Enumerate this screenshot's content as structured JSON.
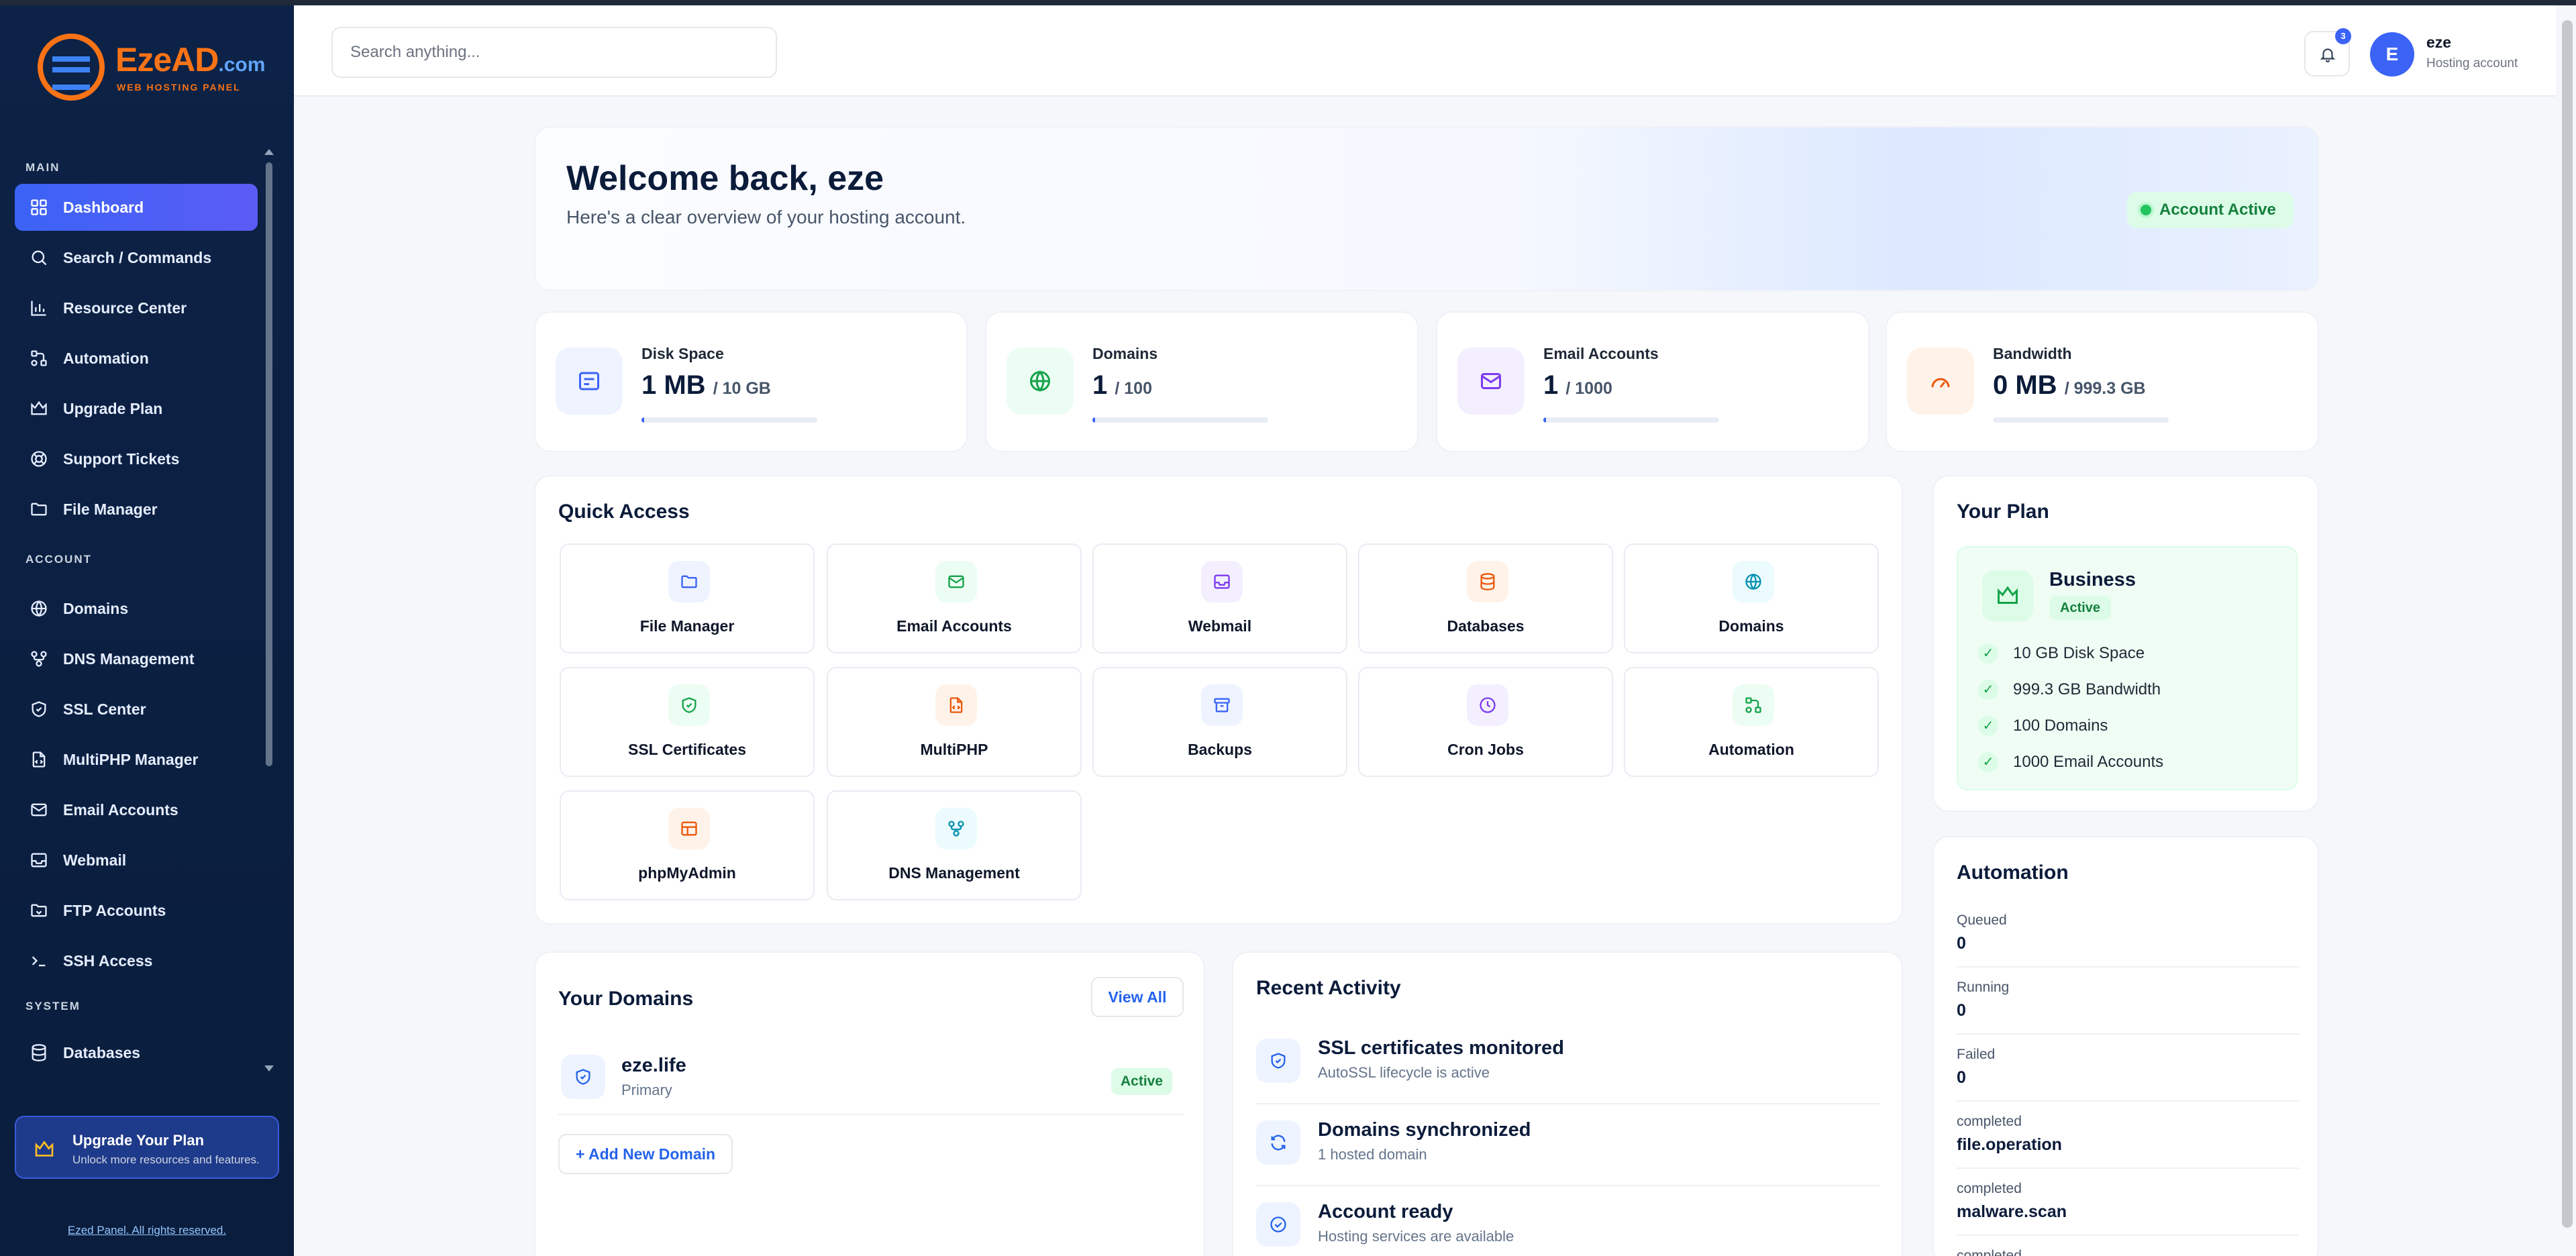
{
  "brand": {
    "name": "EzeAD",
    "tld": ".com",
    "tagline": "WEB HOSTING PANEL",
    "accent": "#f97316",
    "primary": "#3b63f6"
  },
  "sidebar": {
    "sections": {
      "main": "MAIN",
      "account": "ACCOUNT",
      "system": "SYSTEM"
    },
    "items": [
      {
        "label": "Dashboard",
        "icon": "grid-icon",
        "active": true
      },
      {
        "label": "Search / Commands",
        "icon": "search-icon"
      },
      {
        "label": "Resource Center",
        "icon": "bar-chart-icon"
      },
      {
        "label": "Automation",
        "icon": "workflow-icon"
      },
      {
        "label": "Upgrade Plan",
        "icon": "crown-icon"
      },
      {
        "label": "Support Tickets",
        "icon": "life-buoy-icon"
      },
      {
        "label": "File Manager",
        "icon": "folder-icon"
      },
      {
        "label": "Domains",
        "icon": "globe-icon"
      },
      {
        "label": "DNS Management",
        "icon": "network-icon"
      },
      {
        "label": "SSL Center",
        "icon": "shield-icon"
      },
      {
        "label": "MultiPHP Manager",
        "icon": "file-code-icon"
      },
      {
        "label": "Email Accounts",
        "icon": "mail-icon"
      },
      {
        "label": "Webmail",
        "icon": "inbox-icon"
      },
      {
        "label": "FTP Accounts",
        "icon": "folder-upload-icon"
      },
      {
        "label": "SSH Access",
        "icon": "terminal-icon"
      },
      {
        "label": "Databases",
        "icon": "database-icon"
      }
    ],
    "upgrade": {
      "title": "Upgrade Your Plan",
      "subtitle": "Unlock more resources and features."
    },
    "copyright": "Ezed Panel. All rights reserved."
  },
  "topbar": {
    "search_placeholder": "Search anything...",
    "notifications_count": "3",
    "user": {
      "initial": "E",
      "name": "eze",
      "role": "Hosting account"
    }
  },
  "welcome": {
    "title": "Welcome back, eze",
    "subtitle": "Here's a clear overview of your hosting account.",
    "status": "Account Active"
  },
  "stats": [
    {
      "label": "Disk Space",
      "value": "1 MB",
      "limit": "/ 10 GB",
      "fraction": 0.001,
      "icon": "hard-drive-icon",
      "color": "#3b63f6",
      "bg": "#eef3ff"
    },
    {
      "label": "Domains",
      "value": "1",
      "limit": "/ 100",
      "fraction": 0.01,
      "icon": "globe-icon",
      "color": "#16a34a",
      "bg": "#ecfdf3"
    },
    {
      "label": "Email Accounts",
      "value": "1",
      "limit": "/ 1000",
      "fraction": 0.001,
      "icon": "mail-icon",
      "color": "#7c3aed",
      "bg": "#f3efff"
    },
    {
      "label": "Bandwidth",
      "value": "0 MB",
      "limit": "/ 999.3 GB",
      "fraction": 0,
      "icon": "gauge-icon",
      "color": "#ea580c",
      "bg": "#fff3e9"
    }
  ],
  "quick_access": {
    "title": "Quick Access",
    "items": [
      {
        "label": "File Manager",
        "icon": "folder-icon",
        "color": "#3b63f6",
        "bg": "#eef3ff"
      },
      {
        "label": "Email Accounts",
        "icon": "mail-icon",
        "color": "#16a34a",
        "bg": "#ecfdf3"
      },
      {
        "label": "Webmail",
        "icon": "inbox-icon",
        "color": "#7c3aed",
        "bg": "#f3efff"
      },
      {
        "label": "Databases",
        "icon": "database-icon",
        "color": "#ea580c",
        "bg": "#fff3e9"
      },
      {
        "label": "Domains",
        "icon": "globe-icon",
        "color": "#0891b2",
        "bg": "#ecfbfd"
      },
      {
        "label": "SSL Certificates",
        "icon": "shield-icon",
        "color": "#16a34a",
        "bg": "#ecfdf3"
      },
      {
        "label": "MultiPHP",
        "icon": "file-code-icon",
        "color": "#ea580c",
        "bg": "#fff3e9"
      },
      {
        "label": "Backups",
        "icon": "archive-icon",
        "color": "#3b63f6",
        "bg": "#eef3ff"
      },
      {
        "label": "Cron Jobs",
        "icon": "clock-icon",
        "color": "#7c3aed",
        "bg": "#f3efff"
      },
      {
        "label": "Automation",
        "icon": "workflow-icon",
        "color": "#16a34a",
        "bg": "#ecfdf3"
      },
      {
        "label": "phpMyAdmin",
        "icon": "table-icon",
        "color": "#ea580c",
        "bg": "#fff3e9"
      },
      {
        "label": "DNS Management",
        "icon": "network-icon",
        "color": "#0891b2",
        "bg": "#ecfbfd"
      }
    ]
  },
  "plan": {
    "title": "Your Plan",
    "name": "Business",
    "status": "Active",
    "features": [
      "10 GB Disk Space",
      "999.3 GB Bandwidth",
      "100 Domains",
      "1000 Email Accounts"
    ]
  },
  "automation": {
    "title": "Automation",
    "rows": [
      {
        "label": "Queued",
        "value": "0"
      },
      {
        "label": "Running",
        "value": "0"
      },
      {
        "label": "Failed",
        "value": "0"
      },
      {
        "label": "completed",
        "value": "file.operation"
      },
      {
        "label": "completed",
        "value": "malware.scan"
      },
      {
        "label": "completed",
        "value": ""
      }
    ]
  },
  "your_domains": {
    "title": "Your Domains",
    "view_all": "View All",
    "items": [
      {
        "name": "eze.life",
        "type": "Primary",
        "status": "Active"
      }
    ],
    "add_label": "+ Add New Domain"
  },
  "recent_activity": {
    "title": "Recent Activity",
    "items": [
      {
        "title": "SSL certificates monitored",
        "subtitle": "AutoSSL lifecycle is active",
        "icon": "shield-icon"
      },
      {
        "title": "Domains synchronized",
        "subtitle": "1 hosted domain",
        "icon": "refresh-icon"
      },
      {
        "title": "Account ready",
        "subtitle": "Hosting services are available",
        "icon": "check-circle-icon"
      }
    ]
  }
}
